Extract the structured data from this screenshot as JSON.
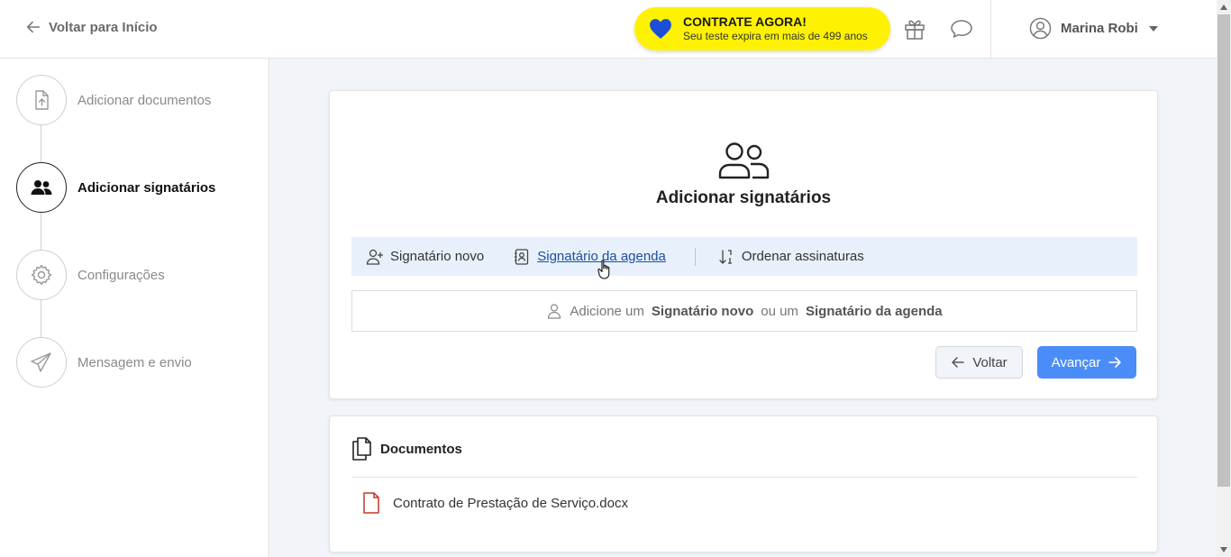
{
  "header": {
    "back_label": "Voltar para Início",
    "promo_title": "CONTRATE AGORA!",
    "promo_subtitle": "Seu teste expira em mais de 499 anos",
    "user_name": "Marina Robi"
  },
  "sidebar": {
    "steps": [
      {
        "label": "Adicionar documentos",
        "icon": "file-upload-icon",
        "active": false
      },
      {
        "label": "Adicionar signatários",
        "icon": "users-icon",
        "active": true
      },
      {
        "label": "Configurações",
        "icon": "gear-icon",
        "active": false
      },
      {
        "label": "Mensagem e envio",
        "icon": "send-icon",
        "active": false
      }
    ]
  },
  "main": {
    "title": "Adicionar signatários",
    "tabs": {
      "new_signer": "Signatário novo",
      "agenda_signer": "Signatário da agenda",
      "order": "Ordenar assinaturas"
    },
    "empty": {
      "prefix": "Adicione um",
      "new_signer": "Signatário novo",
      "middle": "ou um",
      "agenda_signer": "Signatário da agenda"
    },
    "buttons": {
      "back": "Voltar",
      "next": "Avançar"
    }
  },
  "documents": {
    "title": "Documentos",
    "items": [
      "Contrato de Prestação de Serviço.docx"
    ]
  },
  "colors": {
    "promo": "#fff200",
    "primary": "#4b8df8",
    "heart": "#1a4fd6",
    "tabbar": "#e8f1fb"
  }
}
